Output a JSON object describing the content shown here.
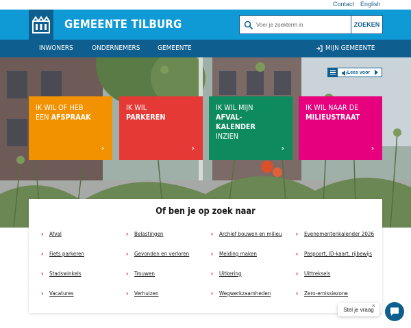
{
  "util_links": {
    "contact": "Contact",
    "english": "English"
  },
  "header": {
    "title": "GEMEENTE TILBURG",
    "search_placeholder": "Voer je zoekterm in",
    "search_button": "ZOEKEN"
  },
  "nav": {
    "items": [
      "INWONERS",
      "ONDERNEMERS",
      "GEMEENTE"
    ],
    "mijn": "MIJN GEMEENTE"
  },
  "read_aloud": {
    "label": "Lees voor"
  },
  "tiles": [
    {
      "line1": "IK WIL OF HEB",
      "line2a": "EEN ",
      "line2b": "AFSPRAAK",
      "color": "#f39200"
    },
    {
      "line1": "IK WIL",
      "line2b": "PARKEREN",
      "color": "#e53935"
    },
    {
      "line1": "IK WIL MIJN",
      "line2b": "AFVAL-",
      "line3b": "KALENDER",
      "line4": "INZIEN",
      "color": "#0e8a5f"
    },
    {
      "line1": "IK WIL NAAR DE",
      "line2b": "MILIEUSTRAAT",
      "color": "#e6007e"
    }
  ],
  "quick_search": {
    "title": "Of ben je op zoek naar",
    "links": [
      "Afval",
      "Belastingen",
      "Archief bouwen en milieu",
      "Evenementenkalender 2026",
      "Fiets parkeren",
      "Gevonden en verloren",
      "Melding maken",
      "Paspoort, ID-kaart, rijbewijs",
      "Stadswinkels",
      "Trouwen",
      "Uitkering",
      "Uittreksels",
      "Vacatures",
      "Verhuizen",
      "Wegwerkzaamheden",
      "Zero-emissiezone"
    ]
  },
  "chat": {
    "label": "Stel je vraag",
    "close": "×"
  },
  "colors": {
    "brand_blue": "#0f9ad6",
    "dark_blue": "#0e5f8f",
    "accent_red": "#c8102e"
  }
}
